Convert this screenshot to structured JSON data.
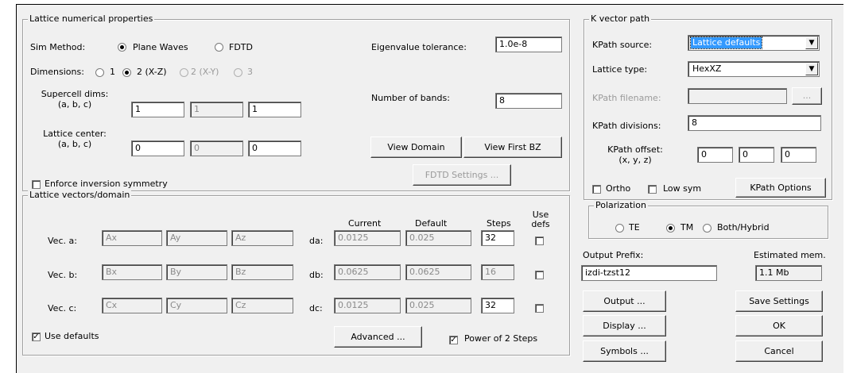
{
  "lattice": {
    "title": "Lattice numerical properties",
    "sim_method_label": "Sim Method:",
    "plane_waves": "Plane Waves",
    "fdtd": "FDTD",
    "dimensions_label": "Dimensions:",
    "dim_1": "1",
    "dim_2xz": "2 (X-Z)",
    "dim_2xy": "2 (X-Y)",
    "dim_3": "3",
    "supercell_label_1": "Supercell dims:",
    "supercell_label_2": "(a, b, c)",
    "supercell": [
      "1",
      "1",
      "1"
    ],
    "center_label_1": "Lattice center:",
    "center_label_2": "(a, b, c)",
    "center": [
      "0",
      "0",
      "0"
    ],
    "eigen_label": "Eigenvalue tolerance:",
    "eigen_value": "1.0e-8",
    "bands_label": "Number of bands:",
    "bands_value": "8",
    "view_domain": "View Domain",
    "view_bz": "View First BZ",
    "fdtd_settings": "FDTD Settings ...",
    "enforce_inversion": "Enforce inversion symmetry"
  },
  "vectors": {
    "title": "Lattice vectors/domain",
    "col_current": "Current",
    "col_default": "Default",
    "col_steps": "Steps",
    "col_use_defs_1": "Use",
    "col_use_defs_2": "defs",
    "rows": [
      {
        "label": "Vec. a:",
        "x": "Ax",
        "y": "Ay",
        "z": "Az",
        "d_label": "da:",
        "current": "0.0125",
        "default": "0.025",
        "steps": "32"
      },
      {
        "label": "Vec. b:",
        "x": "Bx",
        "y": "By",
        "z": "Bz",
        "d_label": "db:",
        "current": "0.0625",
        "default": "0.0625",
        "steps": "16"
      },
      {
        "label": "Vec. c:",
        "x": "Cx",
        "y": "Cy",
        "z": "Cz",
        "d_label": "dc:",
        "current": "0.0125",
        "default": "0.025",
        "steps": "32"
      }
    ],
    "use_defaults": "Use defaults",
    "advanced": "Advanced ...",
    "power_of_2": "Power of 2 Steps",
    "check_mark": "✓"
  },
  "kpath": {
    "title": "K vector path",
    "source_label": "KPath source:",
    "source_value": "Lattice defaults",
    "lattice_type_label": "Lattice type:",
    "lattice_type_value": "HexXZ",
    "filename_label": "KPath filename:",
    "filename_value": "",
    "browse": "...",
    "divisions_label": "KPath divisions:",
    "divisions_value": "8",
    "offset_label_1": "KPath offset:",
    "offset_label_2": "(x, y, z)",
    "offset": [
      "0",
      "0",
      "0"
    ],
    "ortho": "Ortho",
    "low_sym": "Low sym",
    "options": "KPath Options",
    "arrow": "▼"
  },
  "polarization": {
    "title": "Polarization",
    "te": "TE",
    "tm": "TM",
    "both": "Both/Hybrid"
  },
  "output": {
    "prefix_label": "Output Prefix:",
    "prefix_value": "izdi-tzst12",
    "est_mem_label": "Estimated mem.",
    "est_mem_value": "1.1 Mb",
    "output_btn": "Output ...",
    "save_settings": "Save Settings",
    "display_btn": "Display ...",
    "ok": "OK",
    "symbols_btn": "Symbols ...",
    "cancel": "Cancel"
  }
}
